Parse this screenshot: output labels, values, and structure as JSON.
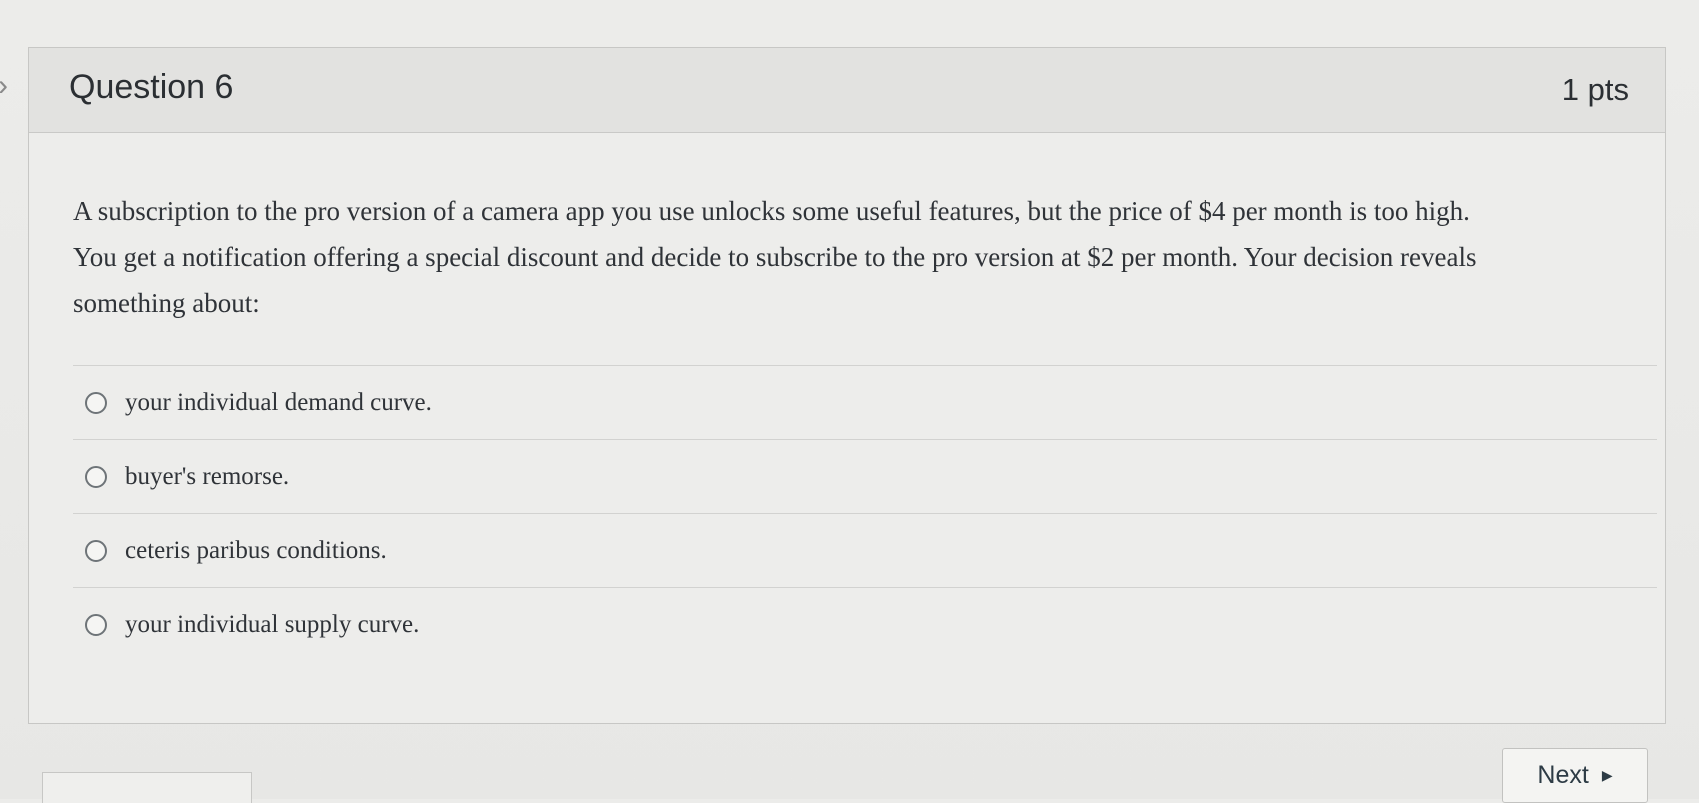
{
  "question": {
    "title": "Question 6",
    "points": "1 pts",
    "prompt_line_1": "A subscription to the pro version of a camera app you use unlocks some useful features, but the price of $4 per month is too high.",
    "prompt_line_2": "You get a notification offering a special discount and decide to subscribe to the pro version at $2 per month. Your decision reveals",
    "prompt_line_3": "something about:"
  },
  "answers": [
    {
      "label": "your individual demand curve."
    },
    {
      "label": "buyer's remorse."
    },
    {
      "label": "ceteris paribus conditions."
    },
    {
      "label": "your individual supply curve."
    }
  ],
  "navigation": {
    "next_label": "Next",
    "next_icon": "caret-right-icon",
    "collapse_icon": "chevron-right-icon"
  }
}
